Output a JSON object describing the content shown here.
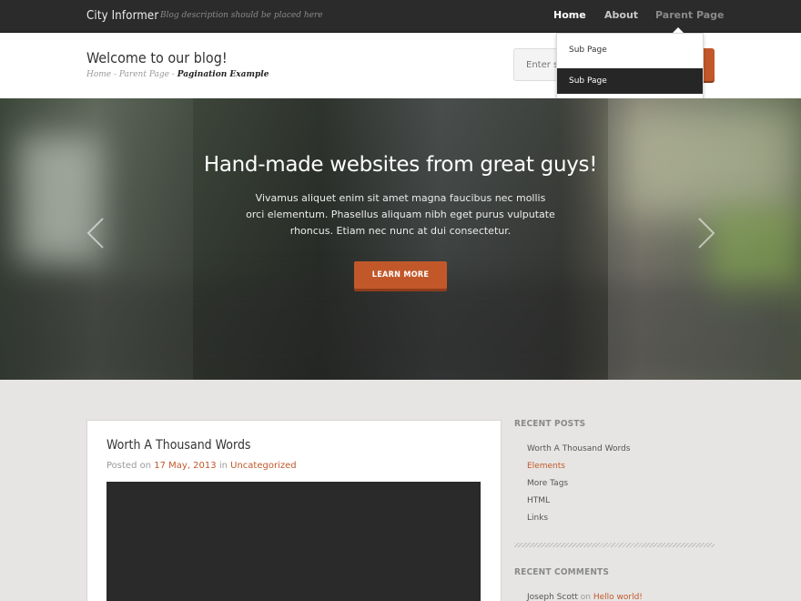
{
  "site": {
    "title": "City Informer",
    "description": "Blog description should be placed here"
  },
  "nav": {
    "items": [
      {
        "label": "Home"
      },
      {
        "label": "About"
      },
      {
        "label": "Parent Page"
      }
    ],
    "dropdown": [
      {
        "label": "Sub Page"
      },
      {
        "label": "Sub Page"
      }
    ]
  },
  "header": {
    "heading": "Welcome to our blog!",
    "breadcrumb": {
      "home": "Home",
      "separator": " - ",
      "parent": "Parent Page",
      "current": "Pagination Example"
    },
    "search_placeholder": "Enter se"
  },
  "hero": {
    "title": "Hand-made websites from great guys!",
    "text": "Vivamus aliquet enim sit amet magna faucibus nec mollis orci elementum. Phasellus aliquam nibh eget purus vulputate rhoncus. Etiam nec nunc at dui consectetur.",
    "button": "LEARN MORE"
  },
  "post": {
    "title": "Worth A Thousand Words",
    "posted_on": "Posted on ",
    "date": "17 May, 2013",
    "in": " in ",
    "category": "Uncategorized"
  },
  "sidebar": {
    "recent_posts_title": "RECENT POSTS",
    "recent_posts": [
      "Worth A Thousand Words",
      "Elements",
      "More Tags",
      "HTML",
      "Links"
    ],
    "recent_comments_title": "RECENT COMMENTS",
    "comment": {
      "author": "Joseph Scott",
      "on": " on ",
      "post": "Hello world!"
    }
  },
  "colors": {
    "accent": "#c2582a",
    "topbar": "#2b2b2b",
    "page_bg": "#e6e5e3"
  }
}
